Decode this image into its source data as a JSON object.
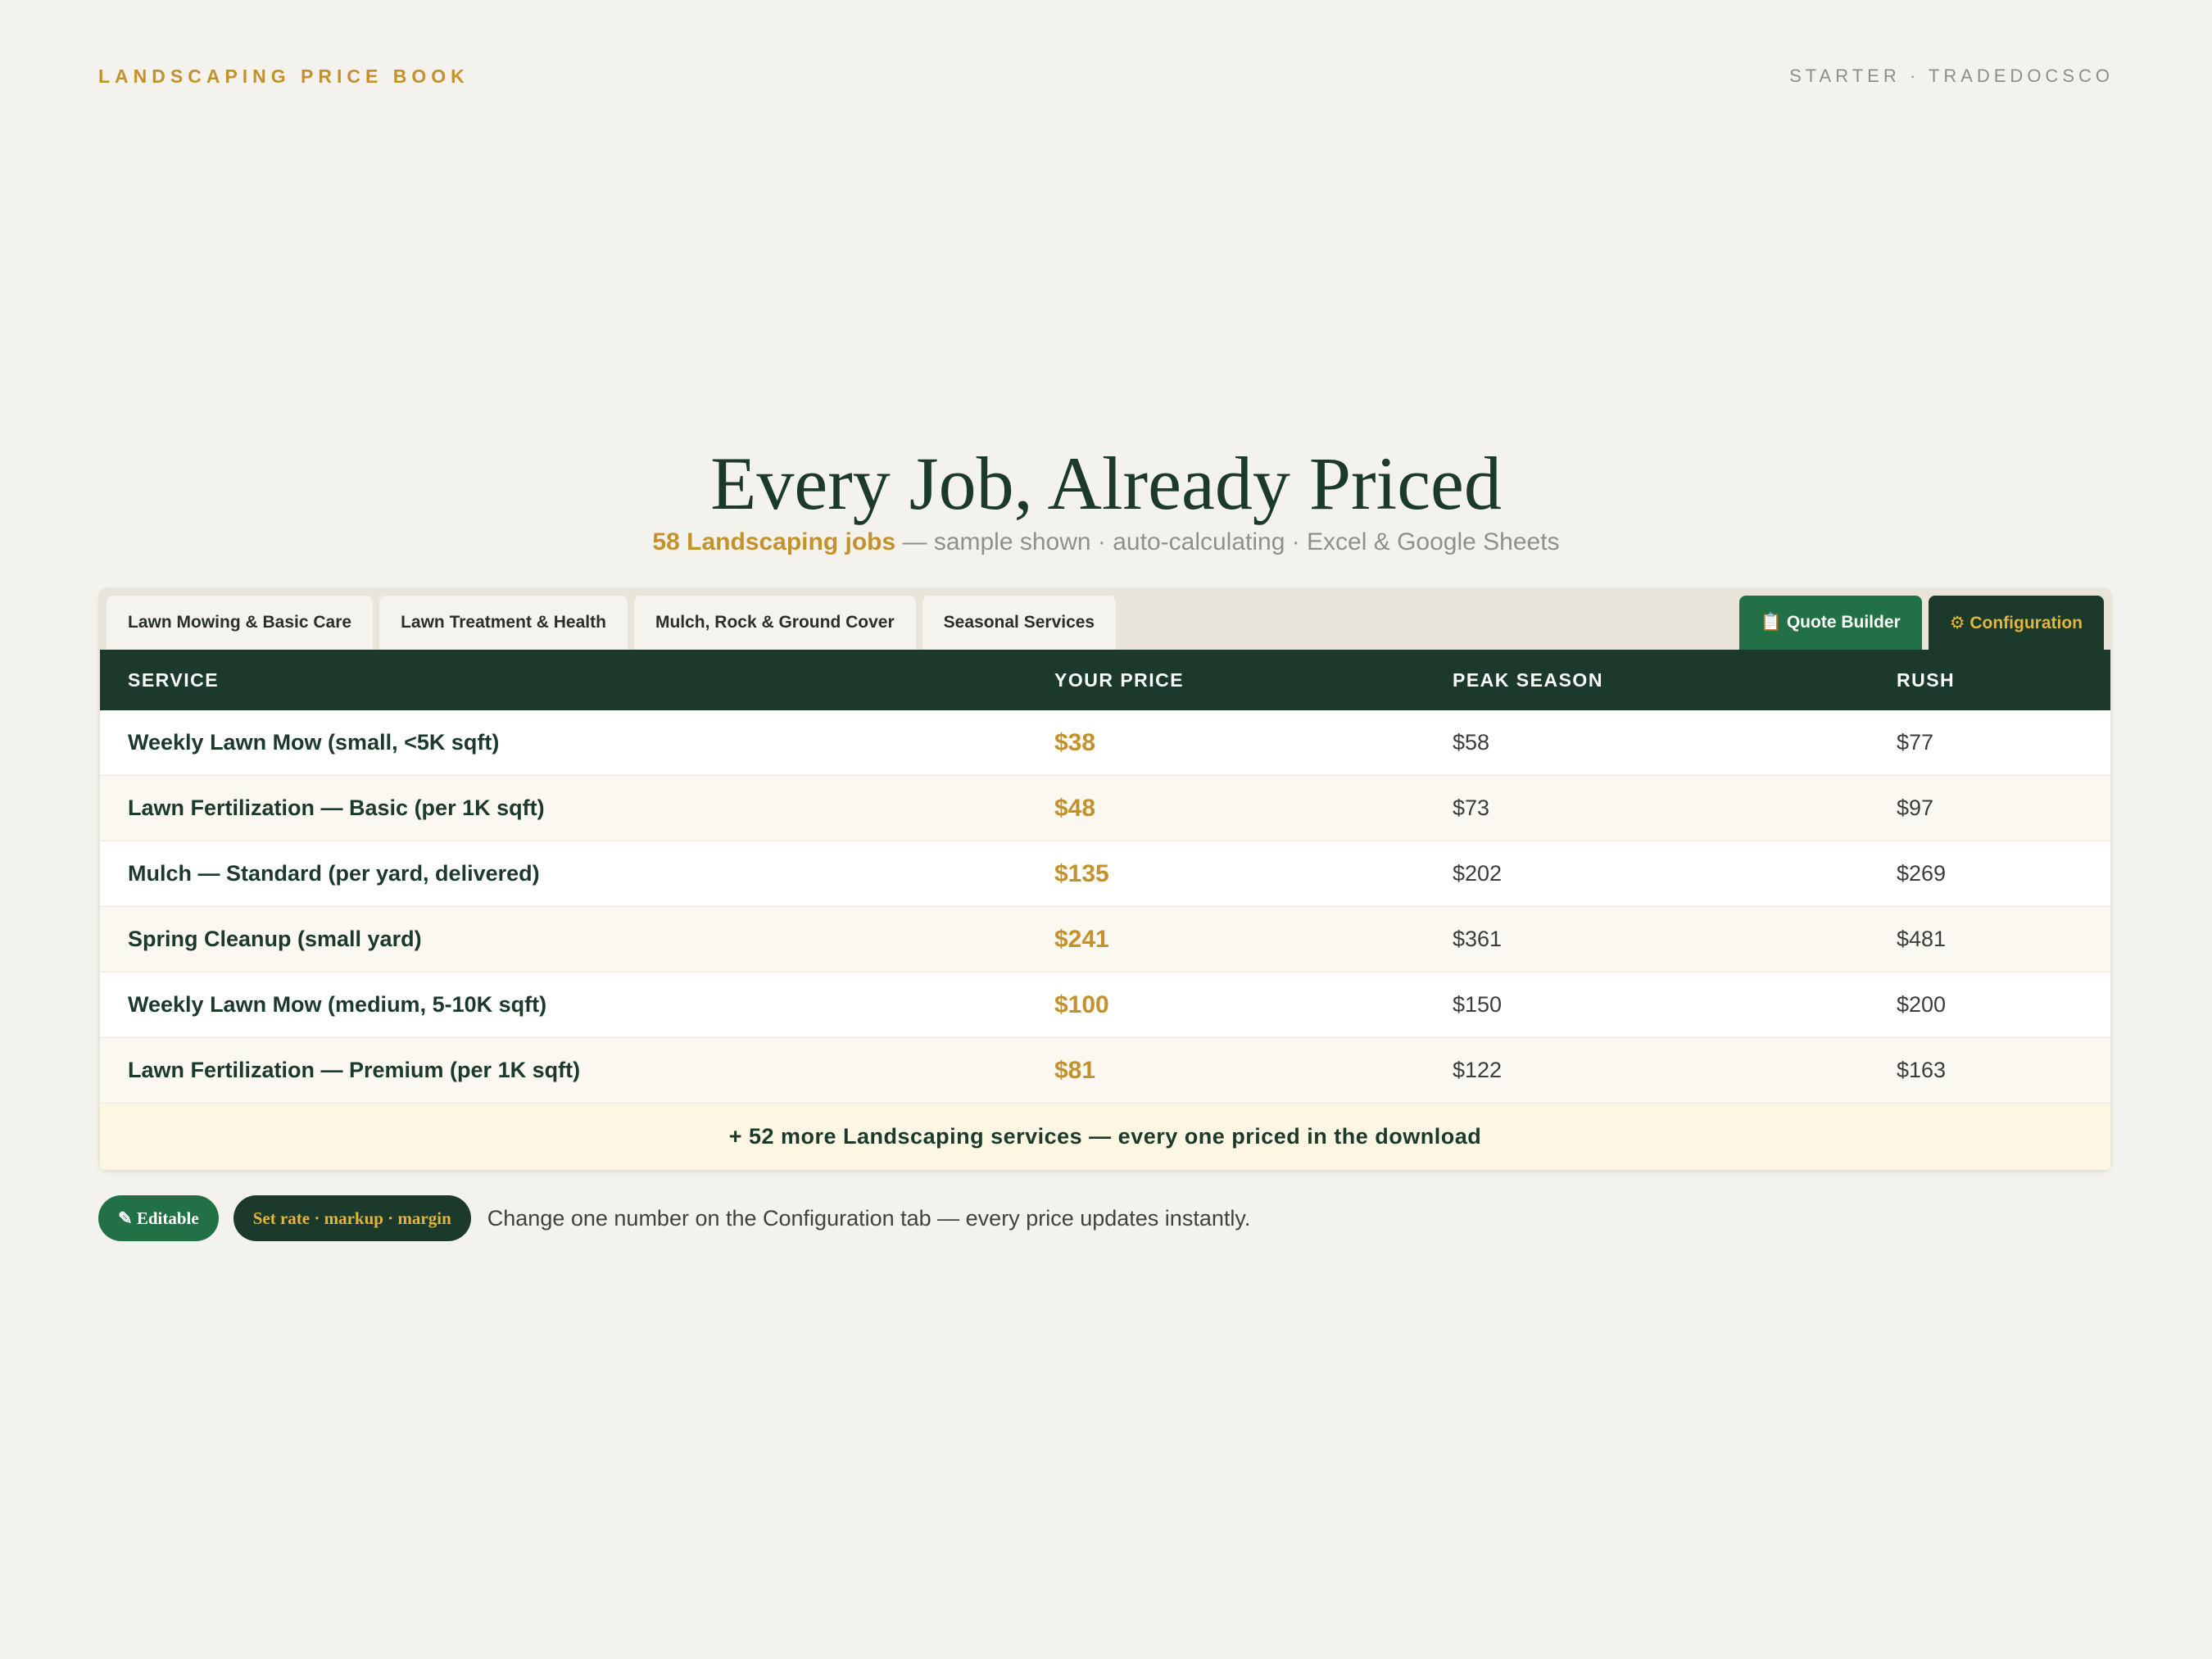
{
  "header": {
    "brand": "LANDSCAPING PRICE BOOK",
    "meta": "STARTER · TRADEDOCSCO"
  },
  "hero": {
    "title": "Every Job, Already Priced",
    "subtitle_accent": "58 Landscaping jobs",
    "subtitle_rest": " — sample shown · auto-calculating · Excel & Google Sheets"
  },
  "tabs": [
    {
      "label": "Lawn Mowing & Basic Care"
    },
    {
      "label": "Lawn Treatment & Health"
    },
    {
      "label": "Mulch, Rock & Ground Cover"
    },
    {
      "label": "Seasonal Services"
    }
  ],
  "actions": {
    "quote_builder": "📋 Quote Builder",
    "configuration": "⚙ Configuration"
  },
  "table": {
    "columns": [
      "SERVICE",
      "YOUR PRICE",
      "PEAK SEASON",
      "RUSH"
    ],
    "rows": [
      {
        "service": "Weekly Lawn Mow (small, <5K sqft)",
        "price": "$38",
        "peak": "$58",
        "rush": "$77"
      },
      {
        "service": "Lawn Fertilization — Basic (per 1K sqft)",
        "price": "$48",
        "peak": "$73",
        "rush": "$97"
      },
      {
        "service": "Mulch — Standard (per yard, delivered)",
        "price": "$135",
        "peak": "$202",
        "rush": "$269"
      },
      {
        "service": "Spring Cleanup (small yard)",
        "price": "$241",
        "peak": "$361",
        "rush": "$481"
      },
      {
        "service": "Weekly Lawn Mow (medium, 5-10K sqft)",
        "price": "$100",
        "peak": "$150",
        "rush": "$200"
      },
      {
        "service": "Lawn Fertilization — Premium (per 1K sqft)",
        "price": "$81",
        "peak": "$122",
        "rush": "$163"
      }
    ],
    "more_label": "+ 52 more Landscaping services — every one priced in the download"
  },
  "footer": {
    "editable_label": "✎ Editable",
    "set_label": "Set rate · markup · margin",
    "note": "Change one number on the Configuration tab — every price updates instantly."
  },
  "colors": {
    "background": "#f4f2ec",
    "dark_green": "#1b3a2b",
    "green": "#227046",
    "gold": "#c4912c",
    "gold_light": "#e2b53c"
  }
}
